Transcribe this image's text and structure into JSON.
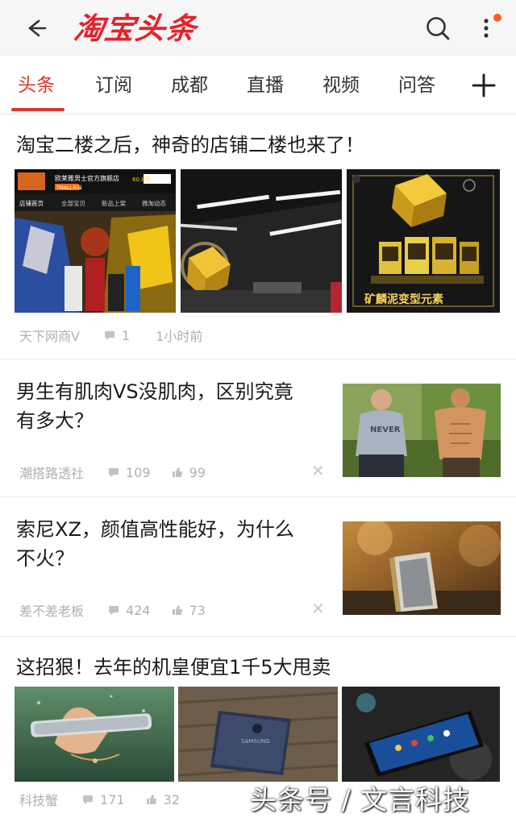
{
  "header": {
    "logo_text": "淘宝头条",
    "back_icon": "back-arrow-icon",
    "search_icon": "search-icon",
    "more_icon": "more-vertical-icon",
    "accent_color": "#d8372d"
  },
  "tabs": [
    {
      "label": "头条",
      "active": true
    },
    {
      "label": "订阅"
    },
    {
      "label": "成都"
    },
    {
      "label": "直播"
    },
    {
      "label": "视频"
    },
    {
      "label": "问答"
    }
  ],
  "articles": [
    {
      "title": "淘宝二楼之后，神奇的店铺二楼也来了！",
      "source": "天下网商V",
      "comments": "1",
      "time": "1小时前",
      "images": [
        "store-page-screenshot",
        "hanging-golden-cube",
        "cube-and-toy-boxes"
      ],
      "image_texts": {
        "store_name": "欧莱雅男士官方旗舰店",
        "store_tabs": [
          "店铺首页",
          "全部宝贝",
          "新品上架",
          "微淘动态"
        ],
        "banner_text": "矿麟泥变型元素"
      }
    },
    {
      "title": "男生有肌肉VS没肌肉，区别究竟有多大？",
      "title_lines": [
        "男生有肌肉VS没肌肉，区别究竟",
        "有多大？"
      ],
      "source": "潮搭路透社",
      "comments": "109",
      "likes": "99",
      "image": "muscle-comparison-photo"
    },
    {
      "title": "索尼XZ，颜值高性能好，为什么不火？",
      "title_lines": [
        "索尼XZ，颜值高性能好，为什么",
        "不火？"
      ],
      "source": "差不差老板",
      "comments": "424",
      "likes": "73",
      "image": "sony-phone-photo"
    },
    {
      "title": "这招狠！去年的机皇便宜1千5大甩卖",
      "source": "科技蟹",
      "comments": "171",
      "likes": "32",
      "images": [
        "phone-in-hand-photo",
        "galaxy-back-photo",
        "galaxy-edge-photo"
      ]
    }
  ],
  "watermark": "头条号 / 文言科技"
}
